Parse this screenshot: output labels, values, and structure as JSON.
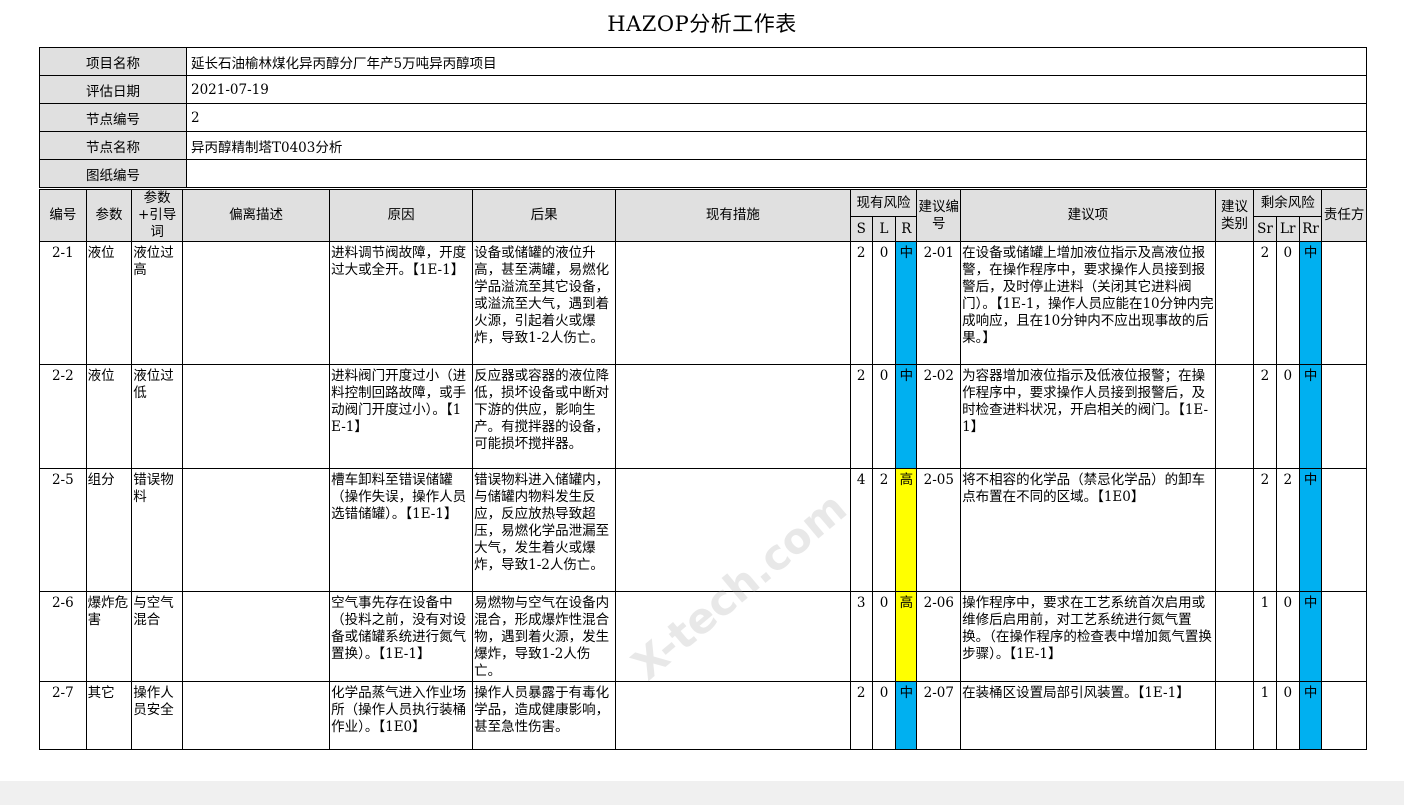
{
  "title": "HAZOP分析工作表",
  "info": [
    {
      "label": "项目名称",
      "value": "延长石油榆林煤化异丙醇分厂年产5万吨异丙醇项目"
    },
    {
      "label": "评估日期",
      "value": "2021-07-19"
    },
    {
      "label": "节点编号",
      "value": "2"
    },
    {
      "label": "节点名称",
      "value": "异丙醇精制塔T0403分析"
    },
    {
      "label": "图纸编号",
      "value": ""
    }
  ],
  "headers": {
    "no": "编号",
    "param": "参数",
    "param_guide": "参数+引导词",
    "deviation": "偏离描述",
    "cause": "原因",
    "consequence": "后果",
    "measures": "现有措施",
    "current_risk": "现有风险",
    "s": "S",
    "l": "L",
    "r": "R",
    "rec_no": "建议编号",
    "recommendation": "建议项",
    "rec_type": "建议类别",
    "residual_risk": "剩余风险",
    "sr": "Sr",
    "lr": "Lr",
    "rr": "Rr",
    "owner": "责任方"
  },
  "rows": [
    {
      "no": "2-1",
      "param": "液位",
      "guide": "液位过高",
      "deviation": "",
      "cause": "进料调节阀故障，开度过大或全开。【1E-1】",
      "consequence": "设备或储罐的液位升高，甚至满罐，易燃化学品溢流至其它设备，或溢流至大气，遇到着火源，引起着火或爆炸，导致1-2人伤亡。",
      "measures": "",
      "s": "2",
      "l": "0",
      "r": "中",
      "r_color": "#00b0f0",
      "rec_no": "2-01",
      "recommendation": "在设备或储罐上增加液位指示及高液位报警，在操作程序中，要求操作人员接到报警后，及时停止进料（关闭其它进料阀门）。【1E-1，操作人员应能在10分钟内完成响应，且在10分钟内不应出现事故的后果。】",
      "rec_type": "",
      "sr": "2",
      "lr": "0",
      "rr": "中",
      "rr_color": "#00b0f0",
      "owner": ""
    },
    {
      "no": "2-2",
      "param": "液位",
      "guide": "液位过低",
      "deviation": "",
      "cause": "进料阀门开度过小（进料控制回路故障，或手动阀门开度过小）。【1E-1】",
      "consequence": "反应器或容器的液位降低，损坏设备或中断对下游的供应，影响生产。有搅拌器的设备，可能损坏搅拌器。",
      "measures": "",
      "s": "2",
      "l": "0",
      "r": "中",
      "r_color": "#00b0f0",
      "rec_no": "2-02",
      "recommendation": "为容器增加液位指示及低液位报警；在操作程序中，要求操作人员接到报警后，及时检查进料状况，开启相关的阀门。【1E-1】",
      "rec_type": "",
      "sr": "2",
      "lr": "0",
      "rr": "中",
      "rr_color": "#00b0f0",
      "owner": ""
    },
    {
      "no": "2-5",
      "param": "组分",
      "guide": "错误物料",
      "deviation": "",
      "cause": "槽车卸料至错误储罐（操作失误，操作人员选错储罐）。【1E-1】",
      "consequence": "错误物料进入储罐内，与储罐内物料发生反应，反应放热导致超压，易燃化学品泄漏至大气，发生着火或爆炸，导致1-2人伤亡。",
      "measures": "",
      "s": "4",
      "l": "2",
      "r": "高",
      "r_color": "#ffff00",
      "rec_no": "2-05",
      "recommendation": "将不相容的化学品（禁忌化学品）的卸车点布置在不同的区域。【1E0】",
      "rec_type": "",
      "sr": "2",
      "lr": "2",
      "rr": "中",
      "rr_color": "#00b0f0",
      "owner": ""
    },
    {
      "no": "2-6",
      "param": "爆炸危害",
      "guide": "与空气混合",
      "deviation": "",
      "cause": "空气事先存在设备中（投料之前，没有对设备或储罐系统进行氮气置换）。【1E-1】",
      "consequence": "易燃物与空气在设备内混合，形成爆炸性混合物，遇到着火源，发生爆炸，导致1-2人伤亡。",
      "measures": "",
      "s": "3",
      "l": "0",
      "r": "高",
      "r_color": "#ffff00",
      "rec_no": "2-06",
      "recommendation": "操作程序中，要求在工艺系统首次启用或维修后启用前，对工艺系统进行氮气置换。（在操作程序的检查表中增加氮气置换步骤）。【1E-1】",
      "rec_type": "",
      "sr": "1",
      "lr": "0",
      "rr": "中",
      "rr_color": "#00b0f0",
      "owner": ""
    },
    {
      "no": "2-7",
      "param": "其它",
      "guide": "操作人员安全",
      "deviation": "",
      "cause": "化学品蒸气进入作业场所（操作人员执行装桶作业）。【1E0】",
      "consequence": "操作人员暴露于有毒化学品，造成健康影响，甚至急性伤害。",
      "measures": "",
      "s": "2",
      "l": "0",
      "r": "中",
      "r_color": "#00b0f0",
      "rec_no": "2-07",
      "recommendation": "在装桶区设置局部引风装置。【1E-1】",
      "rec_type": "",
      "sr": "1",
      "lr": "0",
      "rr": "中",
      "rr_color": "#00b0f0",
      "owner": ""
    }
  ]
}
